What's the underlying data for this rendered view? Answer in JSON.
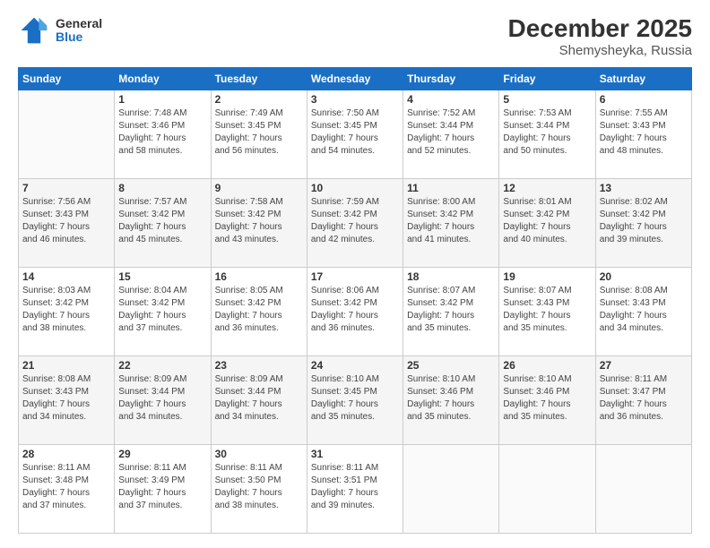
{
  "logo": {
    "general": "General",
    "blue": "Blue"
  },
  "title": "December 2025",
  "location": "Shemysheyka, Russia",
  "days_of_week": [
    "Sunday",
    "Monday",
    "Tuesday",
    "Wednesday",
    "Thursday",
    "Friday",
    "Saturday"
  ],
  "weeks": [
    [
      {
        "day": "",
        "sunrise": "",
        "sunset": "",
        "daylight": ""
      },
      {
        "day": "1",
        "sunrise": "Sunrise: 7:48 AM",
        "sunset": "Sunset: 3:46 PM",
        "daylight": "Daylight: 7 hours and 58 minutes."
      },
      {
        "day": "2",
        "sunrise": "Sunrise: 7:49 AM",
        "sunset": "Sunset: 3:45 PM",
        "daylight": "Daylight: 7 hours and 56 minutes."
      },
      {
        "day": "3",
        "sunrise": "Sunrise: 7:50 AM",
        "sunset": "Sunset: 3:45 PM",
        "daylight": "Daylight: 7 hours and 54 minutes."
      },
      {
        "day": "4",
        "sunrise": "Sunrise: 7:52 AM",
        "sunset": "Sunset: 3:44 PM",
        "daylight": "Daylight: 7 hours and 52 minutes."
      },
      {
        "day": "5",
        "sunrise": "Sunrise: 7:53 AM",
        "sunset": "Sunset: 3:44 PM",
        "daylight": "Daylight: 7 hours and 50 minutes."
      },
      {
        "day": "6",
        "sunrise": "Sunrise: 7:55 AM",
        "sunset": "Sunset: 3:43 PM",
        "daylight": "Daylight: 7 hours and 48 minutes."
      }
    ],
    [
      {
        "day": "7",
        "sunrise": "Sunrise: 7:56 AM",
        "sunset": "Sunset: 3:43 PM",
        "daylight": "Daylight: 7 hours and 46 minutes."
      },
      {
        "day": "8",
        "sunrise": "Sunrise: 7:57 AM",
        "sunset": "Sunset: 3:42 PM",
        "daylight": "Daylight: 7 hours and 45 minutes."
      },
      {
        "day": "9",
        "sunrise": "Sunrise: 7:58 AM",
        "sunset": "Sunset: 3:42 PM",
        "daylight": "Daylight: 7 hours and 43 minutes."
      },
      {
        "day": "10",
        "sunrise": "Sunrise: 7:59 AM",
        "sunset": "Sunset: 3:42 PM",
        "daylight": "Daylight: 7 hours and 42 minutes."
      },
      {
        "day": "11",
        "sunrise": "Sunrise: 8:00 AM",
        "sunset": "Sunset: 3:42 PM",
        "daylight": "Daylight: 7 hours and 41 minutes."
      },
      {
        "day": "12",
        "sunrise": "Sunrise: 8:01 AM",
        "sunset": "Sunset: 3:42 PM",
        "daylight": "Daylight: 7 hours and 40 minutes."
      },
      {
        "day": "13",
        "sunrise": "Sunrise: 8:02 AM",
        "sunset": "Sunset: 3:42 PM",
        "daylight": "Daylight: 7 hours and 39 minutes."
      }
    ],
    [
      {
        "day": "14",
        "sunrise": "Sunrise: 8:03 AM",
        "sunset": "Sunset: 3:42 PM",
        "daylight": "Daylight: 7 hours and 38 minutes."
      },
      {
        "day": "15",
        "sunrise": "Sunrise: 8:04 AM",
        "sunset": "Sunset: 3:42 PM",
        "daylight": "Daylight: 7 hours and 37 minutes."
      },
      {
        "day": "16",
        "sunrise": "Sunrise: 8:05 AM",
        "sunset": "Sunset: 3:42 PM",
        "daylight": "Daylight: 7 hours and 36 minutes."
      },
      {
        "day": "17",
        "sunrise": "Sunrise: 8:06 AM",
        "sunset": "Sunset: 3:42 PM",
        "daylight": "Daylight: 7 hours and 36 minutes."
      },
      {
        "day": "18",
        "sunrise": "Sunrise: 8:07 AM",
        "sunset": "Sunset: 3:42 PM",
        "daylight": "Daylight: 7 hours and 35 minutes."
      },
      {
        "day": "19",
        "sunrise": "Sunrise: 8:07 AM",
        "sunset": "Sunset: 3:43 PM",
        "daylight": "Daylight: 7 hours and 35 minutes."
      },
      {
        "day": "20",
        "sunrise": "Sunrise: 8:08 AM",
        "sunset": "Sunset: 3:43 PM",
        "daylight": "Daylight: 7 hours and 34 minutes."
      }
    ],
    [
      {
        "day": "21",
        "sunrise": "Sunrise: 8:08 AM",
        "sunset": "Sunset: 3:43 PM",
        "daylight": "Daylight: 7 hours and 34 minutes."
      },
      {
        "day": "22",
        "sunrise": "Sunrise: 8:09 AM",
        "sunset": "Sunset: 3:44 PM",
        "daylight": "Daylight: 7 hours and 34 minutes."
      },
      {
        "day": "23",
        "sunrise": "Sunrise: 8:09 AM",
        "sunset": "Sunset: 3:44 PM",
        "daylight": "Daylight: 7 hours and 34 minutes."
      },
      {
        "day": "24",
        "sunrise": "Sunrise: 8:10 AM",
        "sunset": "Sunset: 3:45 PM",
        "daylight": "Daylight: 7 hours and 35 minutes."
      },
      {
        "day": "25",
        "sunrise": "Sunrise: 8:10 AM",
        "sunset": "Sunset: 3:46 PM",
        "daylight": "Daylight: 7 hours and 35 minutes."
      },
      {
        "day": "26",
        "sunrise": "Sunrise: 8:10 AM",
        "sunset": "Sunset: 3:46 PM",
        "daylight": "Daylight: 7 hours and 35 minutes."
      },
      {
        "day": "27",
        "sunrise": "Sunrise: 8:11 AM",
        "sunset": "Sunset: 3:47 PM",
        "daylight": "Daylight: 7 hours and 36 minutes."
      }
    ],
    [
      {
        "day": "28",
        "sunrise": "Sunrise: 8:11 AM",
        "sunset": "Sunset: 3:48 PM",
        "daylight": "Daylight: 7 hours and 37 minutes."
      },
      {
        "day": "29",
        "sunrise": "Sunrise: 8:11 AM",
        "sunset": "Sunset: 3:49 PM",
        "daylight": "Daylight: 7 hours and 37 minutes."
      },
      {
        "day": "30",
        "sunrise": "Sunrise: 8:11 AM",
        "sunset": "Sunset: 3:50 PM",
        "daylight": "Daylight: 7 hours and 38 minutes."
      },
      {
        "day": "31",
        "sunrise": "Sunrise: 8:11 AM",
        "sunset": "Sunset: 3:51 PM",
        "daylight": "Daylight: 7 hours and 39 minutes."
      },
      {
        "day": "",
        "sunrise": "",
        "sunset": "",
        "daylight": ""
      },
      {
        "day": "",
        "sunrise": "",
        "sunset": "",
        "daylight": ""
      },
      {
        "day": "",
        "sunrise": "",
        "sunset": "",
        "daylight": ""
      }
    ]
  ]
}
